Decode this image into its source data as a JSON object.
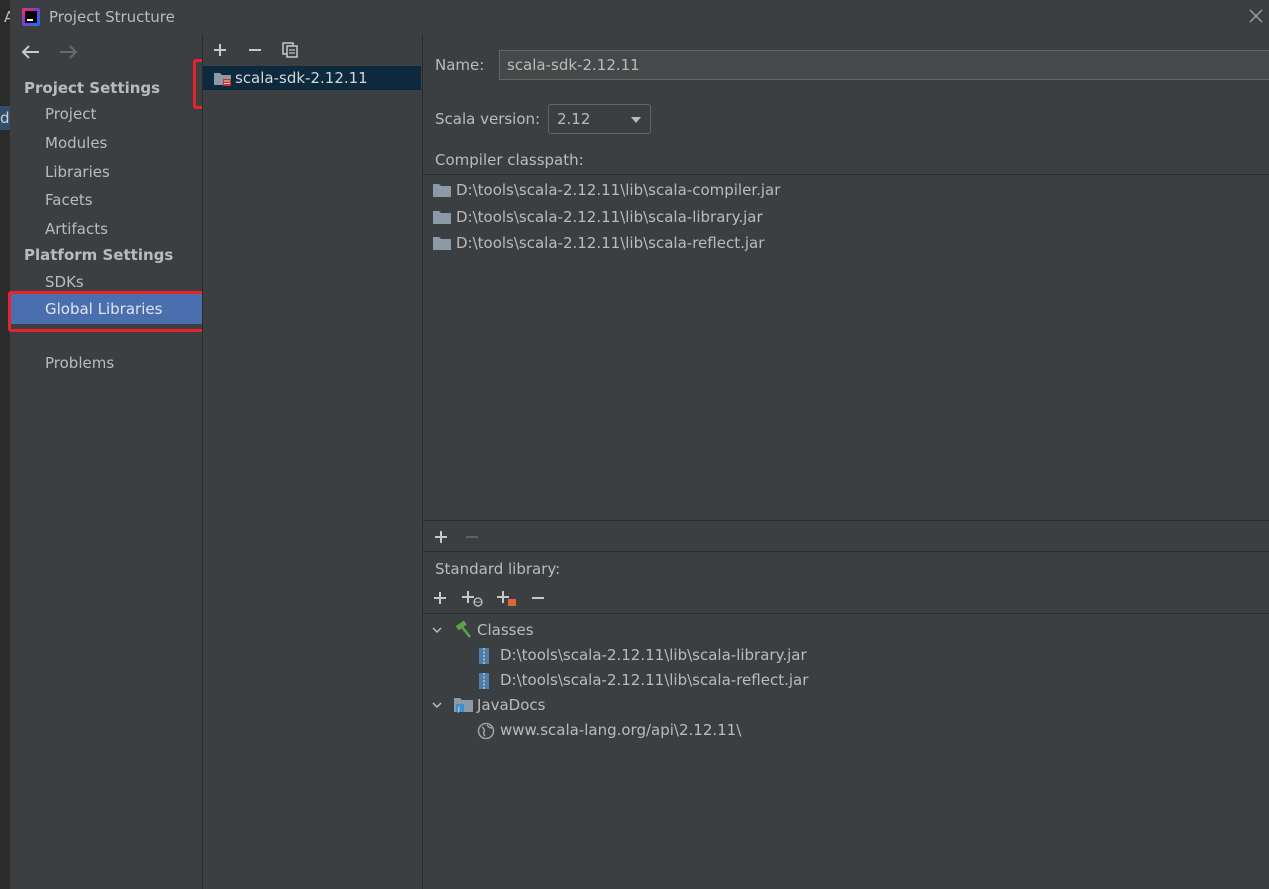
{
  "window": {
    "title": "Project Structure",
    "left_fragments": {
      "a": "A",
      "d": "d"
    }
  },
  "sidebar": {
    "project_settings_title": "Project Settings",
    "project_items": [
      "Project",
      "Modules",
      "Libraries",
      "Facets",
      "Artifacts"
    ],
    "platform_settings_title": "Platform Settings",
    "platform_items": [
      "SDKs",
      "Global Libraries"
    ],
    "selected_item": "Global Libraries",
    "problems": "Problems"
  },
  "libraries": {
    "items": [
      {
        "name": "scala-sdk-2.12.11"
      }
    ]
  },
  "detail": {
    "name_label": "Name:",
    "name_value": "scala-sdk-2.12.11",
    "scala_version_label": "Scala version:",
    "scala_version_value": "2.12",
    "compiler_classpath_label": "Compiler classpath:",
    "compiler_classpath": [
      "D:\\tools\\scala-2.12.11\\lib\\scala-compiler.jar",
      "D:\\tools\\scala-2.12.11\\lib\\scala-library.jar",
      "D:\\tools\\scala-2.12.11\\lib\\scala-reflect.jar"
    ],
    "standard_library_label": "Standard library:",
    "tree": {
      "classes_label": "Classes",
      "classes": [
        "D:\\tools\\scala-2.12.11\\lib\\scala-library.jar",
        "D:\\tools\\scala-2.12.11\\lib\\scala-reflect.jar"
      ],
      "javadocs_label": "JavaDocs",
      "javadocs": [
        "www.scala-lang.org/api\\2.12.11\\"
      ]
    }
  },
  "colors": {
    "background": "#3c3f41",
    "selection": "#4b6eaf",
    "list_selection": "#0d293e",
    "highlight_box": "#e8242a"
  }
}
